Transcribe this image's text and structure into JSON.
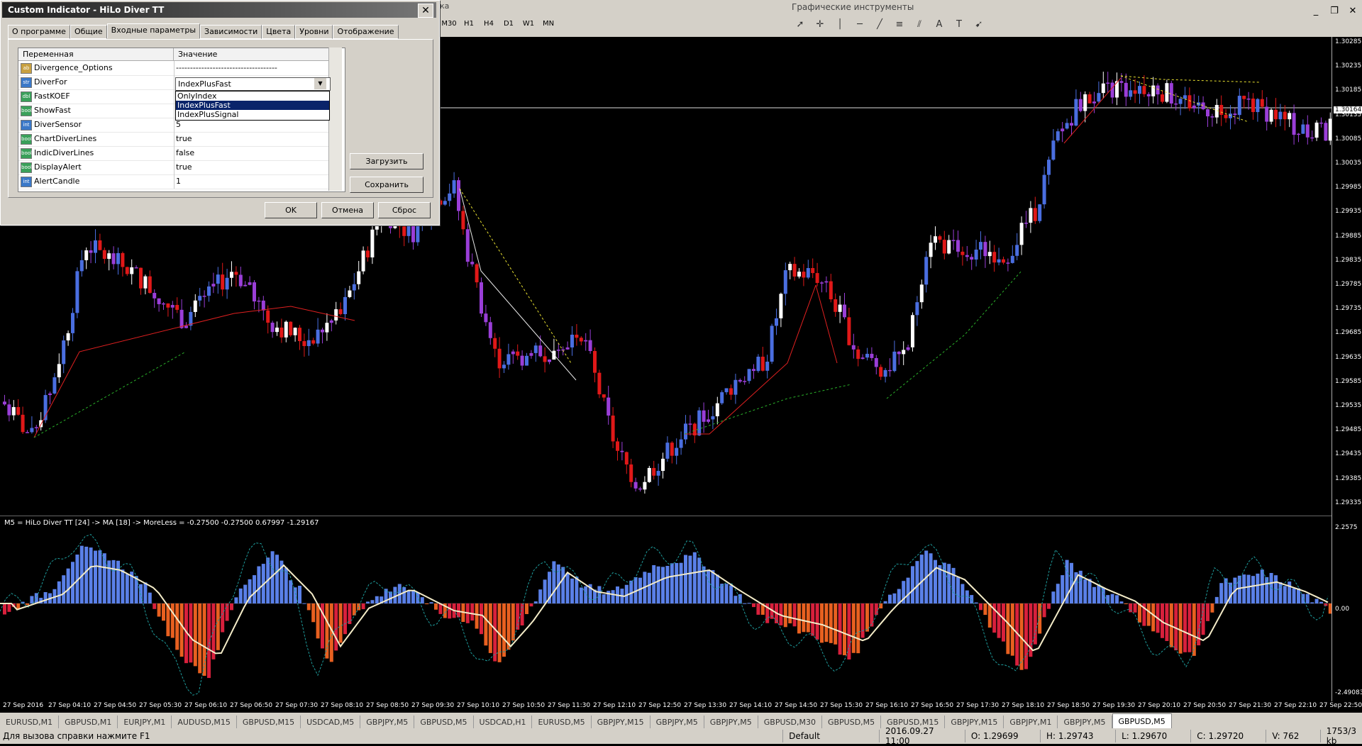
{
  "dialog": {
    "title": "Custom Indicator - HiLo Diver TT",
    "tabs": [
      "О программе",
      "Общие",
      "Входные параметры",
      "Зависимости",
      "Цвета",
      "Уровни",
      "Отображение"
    ],
    "active_tab": 2,
    "columns": {
      "var": "Переменная",
      "val": "Значение"
    },
    "params": [
      {
        "icon": "ab",
        "name": "Divergence_Options",
        "value": "------------------------------------"
      },
      {
        "icon": "str",
        "name": "DiverFor",
        "value": "IndexPlusFast"
      },
      {
        "icon": "dbl",
        "name": "FastKOEF",
        "value": ""
      },
      {
        "icon": "bool",
        "name": "ShowFast",
        "value": ""
      },
      {
        "icon": "int",
        "name": "DiverSensor",
        "value": "5"
      },
      {
        "icon": "bool",
        "name": "ChartDiverLines",
        "value": "true"
      },
      {
        "icon": "bool",
        "name": "IndicDiverLines",
        "value": "false"
      },
      {
        "icon": "bool",
        "name": "DisplayAlert",
        "value": "true"
      },
      {
        "icon": "int",
        "name": "AlertCandle",
        "value": "1"
      }
    ],
    "combo_value": "IndexPlusFast",
    "dropdown_options": [
      "OnlyIndex",
      "IndexPlusFast",
      "IndexPlusSignal"
    ],
    "dropdown_selected": 1,
    "buttons": {
      "load": "Загрузить",
      "save": "Сохранить",
      "ok": "OK",
      "cancel": "Отмена",
      "reset": "Сброс"
    }
  },
  "toolbar": {
    "pre_tab": "ка",
    "timeframes": [
      "M30",
      "H1",
      "H4",
      "D1",
      "W1",
      "MN"
    ],
    "graphic_tools_title": "Графические инструменты"
  },
  "chart": {
    "price_ticks": [
      "1.30285",
      "1.30235",
      "1.30185",
      "1.30135",
      "1.30085",
      "1.30035",
      "1.29985",
      "1.29935",
      "1.29885",
      "1.29835",
      "1.29785",
      "1.29735",
      "1.29685",
      "1.29635",
      "1.29585",
      "1.29535",
      "1.29485",
      "1.29435",
      "1.29385",
      "1.29335"
    ],
    "current_price": "1.30164",
    "ind_ticks": [
      "2.2575",
      "0.00",
      "-2.49083"
    ],
    "ind_label": "M5 = HiLo Diver TT [24] -> MA [18] -> MoreLess = -0.27500 -0.27500 0.67997 -1.29167",
    "time_labels": [
      "27 Sep 2016",
      "27 Sep 04:10",
      "27 Sep 04:50",
      "27 Sep 05:30",
      "27 Sep 06:10",
      "27 Sep 06:50",
      "27 Sep 07:30",
      "27 Sep 08:10",
      "27 Sep 08:50",
      "27 Sep 09:30",
      "27 Sep 10:10",
      "27 Sep 10:50",
      "27 Sep 11:30",
      "27 Sep 12:10",
      "27 Sep 12:50",
      "27 Sep 13:30",
      "27 Sep 14:10",
      "27 Sep 14:50",
      "27 Sep 15:30",
      "27 Sep 16:10",
      "27 Sep 16:50",
      "27 Sep 17:30",
      "27 Sep 18:10",
      "27 Sep 18:50",
      "27 Sep 19:30",
      "27 Sep 20:10",
      "27 Sep 20:50",
      "27 Sep 21:30",
      "27 Sep 22:10",
      "27 Sep 22:50"
    ],
    "colors": {
      "bull": "#4a6ee0",
      "bear": "#e01818",
      "neutral": "#9a3ed8",
      "white": "#ffffff",
      "hist_up": "#5a80e8",
      "hist_dn": "#d8203c",
      "hist_dn2": "#e86020",
      "ma": "#f4ecc8",
      "fast": "#1e9c9c"
    }
  },
  "symbol_tabs": [
    "EURUSD,M1",
    "GBPUSD,M1",
    "EURJPY,M1",
    "AUDUSD,M15",
    "GBPUSD,M15",
    "USDCAD,M5",
    "GBPJPY,M5",
    "GBPUSD,M5",
    "USDCAD,H1",
    "EURUSD,M5",
    "GBPJPY,M15",
    "GBPJPY,M5",
    "GBPJPY,M5",
    "GBPUSD,M30",
    "GBPUSD,M5",
    "GBPUSD,M15",
    "GBPJPY,M15",
    "GBPJPY,M1",
    "GBPJPY,M5",
    "GBPUSD,M5"
  ],
  "active_symbol_tab": 19,
  "status": {
    "help": "Для вызова справки нажмите F1",
    "profile": "Default",
    "datetime": "2016.09.27 11:00",
    "open": "O: 1.29699",
    "high": "H: 1.29743",
    "low": "L: 1.29670",
    "close": "C: 1.29720",
    "volume": "V: 762",
    "traffic": "1753/3 kb"
  }
}
